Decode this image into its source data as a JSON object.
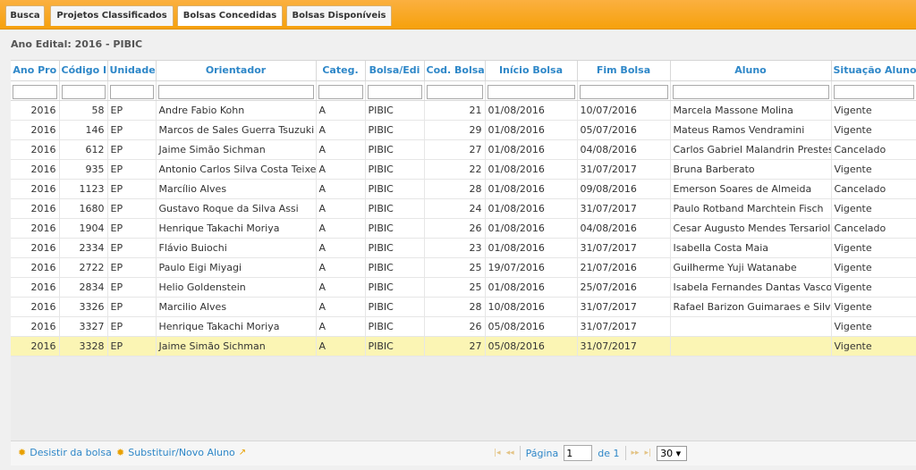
{
  "tabs": [
    {
      "label": "Busca"
    },
    {
      "label": "Projetos Classificados"
    },
    {
      "label": "Bolsas Concedidas"
    },
    {
      "label": "Bolsas Disponíveis"
    }
  ],
  "edital_label": "Ano Edital: 2016 - PIBIC",
  "columns": [
    "Ano Pro",
    "Código I",
    "Unidade",
    "Orientador",
    "Categ.",
    "Bolsa/Edi",
    "Cod. Bolsa",
    "Início Bolsa",
    "Fim Bolsa",
    "Aluno",
    "Situação Aluno"
  ],
  "rows": [
    [
      "2016",
      "58",
      "EP",
      "Andre Fabio Kohn",
      "A",
      "PIBIC",
      "21",
      "01/08/2016",
      "10/07/2016",
      "Marcela Massone Molina",
      "Vigente"
    ],
    [
      "2016",
      "146",
      "EP",
      "Marcos de Sales Guerra Tsuzuki",
      "A",
      "PIBIC",
      "29",
      "01/08/2016",
      "05/07/2016",
      "Mateus Ramos Vendramini",
      "Vigente"
    ],
    [
      "2016",
      "612",
      "EP",
      "Jaime Simão Sichman",
      "A",
      "PIBIC",
      "27",
      "01/08/2016",
      "04/08/2016",
      "Carlos Gabriel Malandrin Prestes",
      "Cancelado"
    ],
    [
      "2016",
      "935",
      "EP",
      "Antonio Carlos Silva Costa Teixeira",
      "A",
      "PIBIC",
      "22",
      "01/08/2016",
      "31/07/2017",
      "Bruna Barberato",
      "Vigente"
    ],
    [
      "2016",
      "1123",
      "EP",
      "Marcílio Alves",
      "A",
      "PIBIC",
      "28",
      "01/08/2016",
      "09/08/2016",
      "Emerson Soares de Almeida",
      "Cancelado"
    ],
    [
      "2016",
      "1680",
      "EP",
      "Gustavo Roque da Silva Assi",
      "A",
      "PIBIC",
      "24",
      "01/08/2016",
      "31/07/2017",
      "Paulo Rotband Marchtein Fisch",
      "Vigente"
    ],
    [
      "2016",
      "1904",
      "EP",
      "Henrique Takachi Moriya",
      "A",
      "PIBIC",
      "26",
      "01/08/2016",
      "04/08/2016",
      "Cesar Augusto Mendes Tersariol",
      "Cancelado"
    ],
    [
      "2016",
      "2334",
      "EP",
      "Flávio Buiochi",
      "A",
      "PIBIC",
      "23",
      "01/08/2016",
      "31/07/2017",
      "Isabella Costa Maia",
      "Vigente"
    ],
    [
      "2016",
      "2722",
      "EP",
      "Paulo Eigi Miyagi",
      "A",
      "PIBIC",
      "25",
      "19/07/2016",
      "21/07/2016",
      "Guilherme Yuji Watanabe",
      "Vigente"
    ],
    [
      "2016",
      "2834",
      "EP",
      "Helio Goldenstein",
      "A",
      "PIBIC",
      "25",
      "01/08/2016",
      "25/07/2016",
      "Isabela Fernandes Dantas Vasconcelos",
      "Vigente"
    ],
    [
      "2016",
      "3326",
      "EP",
      "Marcilio Alves",
      "A",
      "PIBIC",
      "28",
      "10/08/2016",
      "31/07/2017",
      "Rafael Barizon Guimaraes e Silva",
      "Vigente"
    ],
    [
      "2016",
      "3327",
      "EP",
      "Henrique Takachi Moriya",
      "A",
      "PIBIC",
      "26",
      "05/08/2016",
      "31/07/2017",
      "",
      "Vigente"
    ],
    [
      "2016",
      "3328",
      "EP",
      "Jaime Simão Sichman",
      "A",
      "PIBIC",
      "27",
      "05/08/2016",
      "31/07/2017",
      "",
      "Vigente"
    ]
  ],
  "selected_row": 12,
  "footer": {
    "desistir": "Desistir da bolsa",
    "substituir": "Substituir/Novo Aluno",
    "page_label": "Página",
    "page_value": "1",
    "of_label": "de 1",
    "page_size": "30"
  },
  "colors": {
    "accent": "#f6a10c",
    "header_text": "#2e87c8",
    "selected_row": "#fbf5b4"
  }
}
